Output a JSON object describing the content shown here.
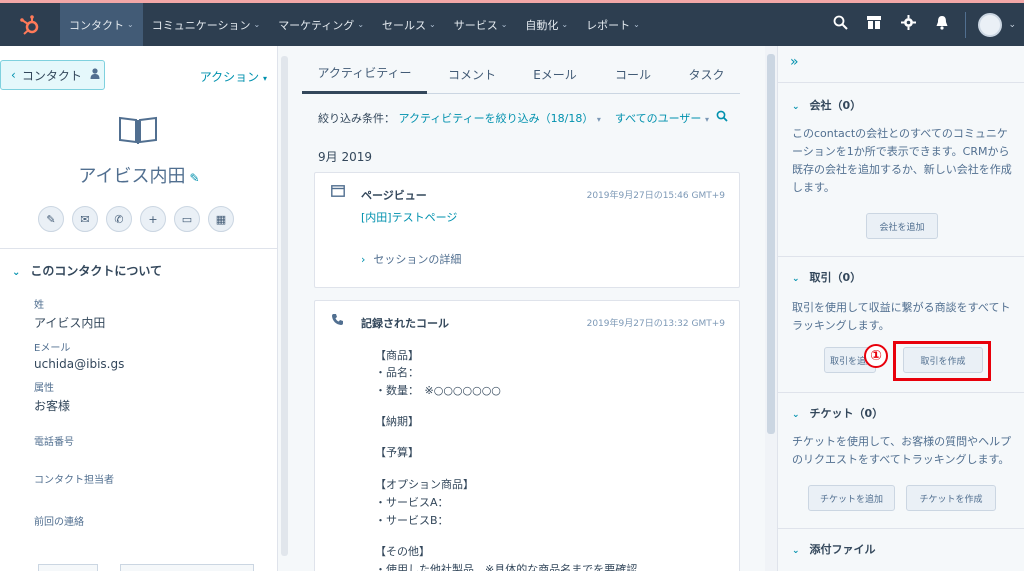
{
  "nav": {
    "items": [
      {
        "label": "コンタクト",
        "active": true
      },
      {
        "label": "コミュニケーション"
      },
      {
        "label": "マーケティング"
      },
      {
        "label": "セールス"
      },
      {
        "label": "サービス"
      },
      {
        "label": "自動化"
      },
      {
        "label": "レポート"
      }
    ],
    "icons": [
      "search-icon",
      "marketplace-icon",
      "settings-icon",
      "notifications-icon"
    ]
  },
  "left": {
    "back_label": "コンタクト",
    "actions_label": "アクション",
    "contact_name": "アイビス内田",
    "quick_actions": [
      "note-icon",
      "email-icon",
      "call-icon",
      "add-icon",
      "meeting-icon",
      "calendar-icon"
    ],
    "about_title": "このコンタクトについて",
    "properties": [
      {
        "label": "姓",
        "value": "アイビス内田"
      },
      {
        "label": "Eメール",
        "value": "uchida@ibis.gs"
      },
      {
        "label": "属性",
        "value": "お客様"
      },
      {
        "label": "電話番号",
        "value": ""
      },
      {
        "label": "コンタクト担当者",
        "value": ""
      },
      {
        "label": "前回の連絡",
        "value": ""
      }
    ]
  },
  "timeline": {
    "tabs": [
      "アクティビティー",
      "コメント",
      "Eメール",
      "コール",
      "タスク"
    ],
    "filter_prefix": "絞り込み条件：",
    "filter_activity": "アクティビティーを絞り込み（18/18）",
    "filter_users": "すべてのユーザー",
    "month": "9月 2019",
    "pageview": {
      "title": "ページビュー",
      "date": "2019年9月27日の15:46 GMT+9",
      "link": "[内田]テストページ",
      "details": "セッションの詳細"
    },
    "call": {
      "title": "記録されたコール",
      "date": "2019年9月27日の13:32 GMT+9",
      "lines": [
        "【商品】",
        "・品名：",
        "・数量：　※○○○○○○○",
        "【納期】",
        "【予算】",
        "【オプション商品】",
        "・サービスA：",
        "・サービスB：",
        "【その他】",
        "・使用した他社製品　※具体的な商品名までを要確認"
      ]
    }
  },
  "sidebar": {
    "company": {
      "title": "会社（0）",
      "desc": "このcontactの会社とのすべてのコミュニケーションを1か所で表示できます。CRMから既存の会社を追加するか、新しい会社を作成します。",
      "button": "会社を追加"
    },
    "deals": {
      "title": "取引（0）",
      "desc": "取引を使用して収益に繋がる商談をすべてトラッキングします。",
      "add_button": "取引を追加",
      "create_button": "取引を作成"
    },
    "tickets": {
      "title": "チケット（0）",
      "desc": "チケットを使用して、お客様の質問やヘルプのリクエストをすべてトラッキングします。",
      "add_button": "チケットを追加",
      "create_button": "チケットを作成"
    },
    "attachments": {
      "title": "添付ファイル"
    }
  },
  "annotation": {
    "number": "①"
  }
}
